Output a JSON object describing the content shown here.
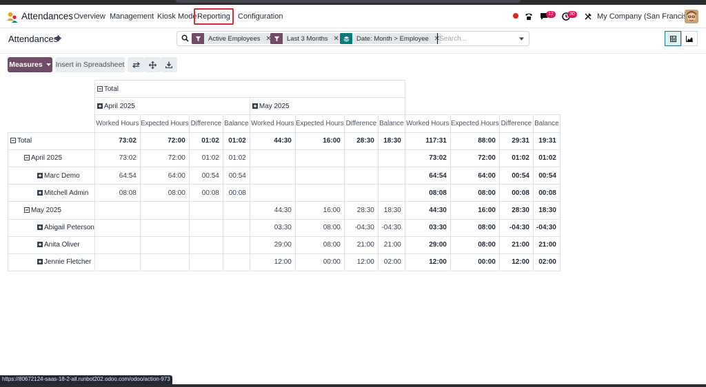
{
  "navbar": {
    "app_name": "Attendances",
    "menu": [
      {
        "label": "Overview"
      },
      {
        "label": "Management"
      },
      {
        "label": "Kiosk Mode"
      },
      {
        "label": "Reporting"
      },
      {
        "label": "Configuration"
      }
    ],
    "chat_badge": "12",
    "activity_badge": "30",
    "company": "My Company (San Francisco)"
  },
  "control_panel": {
    "breadcrumb": "Attendances",
    "facets": [
      {
        "label": "Active Employees",
        "color": "#714b67"
      },
      {
        "label": "Last 3 Months",
        "color": "#714b67"
      },
      {
        "label": "Date: Month > Employee",
        "color": "#0e7a78"
      }
    ],
    "search_placeholder": "Search...",
    "measures_label": "Measures",
    "insert_spreadsheet_label": "Insert in Spreadsheet"
  },
  "pivot": {
    "col_total": "Total",
    "col_groups": [
      "April 2025",
      "May 2025"
    ],
    "measures": [
      "Worked Hours",
      "Expected Hours",
      "Difference",
      "Balance"
    ],
    "rows": [
      {
        "label": "Total",
        "level": 0,
        "toggle": "minus",
        "bold": true,
        "values": [
          "73:02",
          "72:00",
          "01:02",
          "01:02",
          "44:30",
          "16:00",
          "28:30",
          "18:30",
          "117:31",
          "88:00",
          "29:31",
          "19:31"
        ]
      },
      {
        "label": "April 2025",
        "level": 1,
        "toggle": "minus",
        "bold": false,
        "values": [
          "73:02",
          "72:00",
          "01:02",
          "01:02",
          "",
          "",
          "",
          "",
          "73:02",
          "72:00",
          "01:02",
          "01:02"
        ]
      },
      {
        "label": "Marc Demo",
        "level": 2,
        "toggle": "plus",
        "bold": false,
        "values": [
          "64:54",
          "64:00",
          "00:54",
          "00:54",
          "",
          "",
          "",
          "",
          "64:54",
          "64:00",
          "00:54",
          "00:54"
        ]
      },
      {
        "label": "Mitchell Admin",
        "level": 2,
        "toggle": "plus",
        "bold": false,
        "values": [
          "08:08",
          "08:00",
          "00:08",
          "00:08",
          "",
          "",
          "",
          "",
          "08:08",
          "08:00",
          "00:08",
          "00:08"
        ]
      },
      {
        "label": "May 2025",
        "level": 1,
        "toggle": "minus",
        "bold": false,
        "values": [
          "",
          "",
          "",
          "",
          "44:30",
          "16:00",
          "28:30",
          "18:30",
          "44:30",
          "16:00",
          "28:30",
          "18:30"
        ]
      },
      {
        "label": "Abigail Peterson",
        "level": 2,
        "toggle": "plus",
        "bold": false,
        "values": [
          "",
          "",
          "",
          "",
          "03:30",
          "08:00",
          "-04:30",
          "-04:30",
          "03:30",
          "08:00",
          "-04:30",
          "-04:30"
        ]
      },
      {
        "label": "Anita Oliver",
        "level": 2,
        "toggle": "plus",
        "bold": false,
        "values": [
          "",
          "",
          "",
          "",
          "29:00",
          "08:00",
          "21:00",
          "21:00",
          "29:00",
          "08:00",
          "21:00",
          "21:00"
        ]
      },
      {
        "label": "Jennie Fletcher",
        "level": 2,
        "toggle": "plus",
        "bold": false,
        "values": [
          "",
          "",
          "",
          "",
          "12:00",
          "00:00",
          "12:00",
          "02:00",
          "12:00",
          "00:00",
          "12:00",
          "02:00"
        ]
      }
    ]
  },
  "status_url": "https://80672124-saas-18-2-all.runbot202.odoo.com/odoo/action-973",
  "colors": {
    "brand": "#714b67",
    "accent_teal": "#0e7a78",
    "highlight_red": "#d32f2f"
  }
}
